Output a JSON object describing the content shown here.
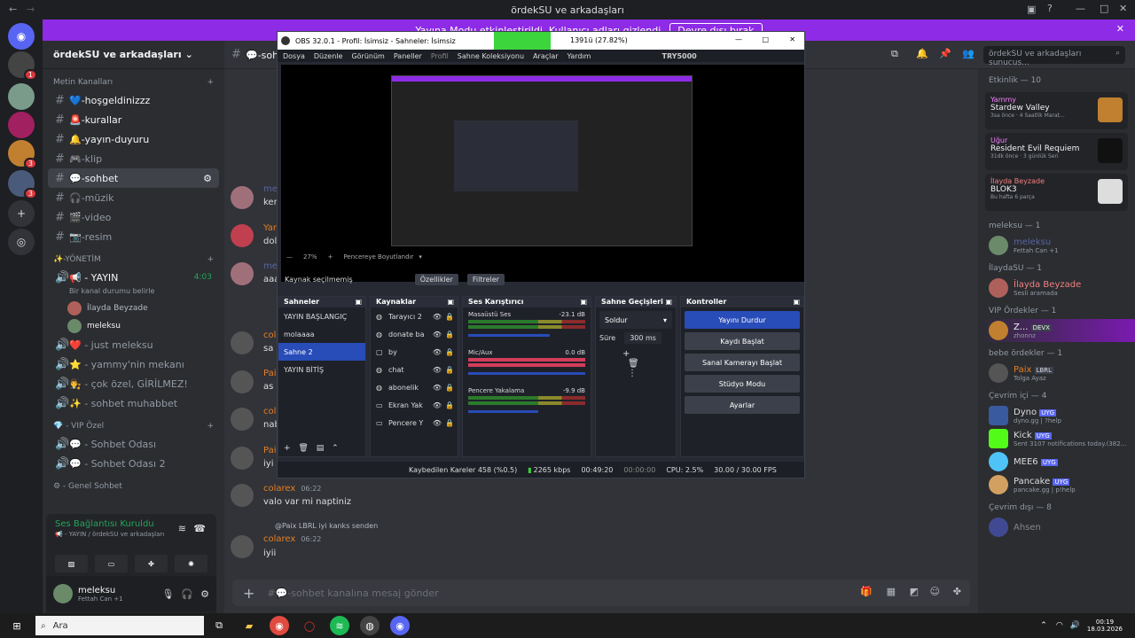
{
  "window": {
    "title": "ördekSU ve arkadaşları"
  },
  "banner": {
    "text": "Yayına Modu etkinleştirildi. Kullanıcı adları gizlendi",
    "button": "Devre dışı bırak"
  },
  "guilds": {
    "badges": [
      "1",
      "3",
      "3"
    ]
  },
  "server": {
    "name": "ördekSU ve arkadaşları"
  },
  "channels": {
    "text_category": "Metin Kanalları",
    "text": [
      "💙-hoşgeldinizzz",
      "🚨-kurallar",
      "🔔-yayın-duyuru",
      "🎮-klip",
      "💬-sohbet",
      "🎧-müzik",
      "🎬-video",
      "📷-resim"
    ],
    "mgmt_category": "✨-YÖNETİM",
    "live_channel": "📢 - YAYIN",
    "live_time": "4:03",
    "live_sub": "Bir kanal durumu belirle",
    "voice_users": [
      "İlayda Beyzade",
      "meleksu"
    ],
    "other": [
      "❤️ - just meleksu",
      "⭐ - yammy'nin mekanı",
      "👨‍⚖️ - çok özel, GİRİLMEZ!",
      "✨ - sohbet muhabbet"
    ],
    "vip_category": "💎 - VIP Özel",
    "vip": [
      "💬 - Sohbet Odası",
      "💬 - Sohbet Odası 2"
    ],
    "general_category": "⚙ - Genel Sohbet"
  },
  "voice_panel": {
    "status": "Ses Bağlantısı Kuruldu",
    "sub": "📢 - YAYIN / ördekSU ve arkadaşları"
  },
  "user": {
    "name": "meleksu",
    "sub": "Fettah Can +1"
  },
  "chat": {
    "channel": "💬-sohbet",
    "messages": [
      {
        "name": "meleksu",
        "text": "ker"
      },
      {
        "name": "Yam",
        "text": "dol"
      },
      {
        "name": "meleksu",
        "text": "aaa"
      },
      {
        "name": "colarex",
        "text": "sa"
      },
      {
        "name": "Pai",
        "text": "as"
      },
      {
        "name": "colarex",
        "text": "nab"
      },
      {
        "name": "Pai",
        "text": "iyi l"
      },
      {
        "name": "colarex",
        "time": "06:22",
        "text": "valo var mi naptiniz"
      },
      {
        "reply": "@Paix LBRL iyi kanks senden",
        "name": "colarex",
        "time": "06:22",
        "text": "iyii"
      }
    ],
    "input_placeholder": "#💬-sohbet kanalına mesaj gönder"
  },
  "search": {
    "placeholder": "ördekSU ve arkadaşları sunucus..."
  },
  "members": {
    "activity_header": "Etkinlik — 10",
    "activities": [
      {
        "user": "Yammy",
        "game": "Stardew Valley",
        "sub": "3sa önce · 4 Saatlik Marat..."
      },
      {
        "user": "Uğur",
        "game": "Resident Evil Requiem",
        "sub": "31dk önce · 3 günlük Seri"
      },
      {
        "user": "İlayda Beyzade",
        "game": "BLOK3",
        "sub": "Bu hafta 6 parça"
      }
    ],
    "groups": [
      {
        "title": "meleksu — 1",
        "items": [
          {
            "name": "meleksu",
            "sub": "Fettah Can +1"
          }
        ]
      },
      {
        "title": "İlaydaSU — 1",
        "items": [
          {
            "name": "İlayda Beyzade",
            "sub": "Sesli aramada"
          }
        ]
      },
      {
        "title": "VIP Ördekler — 1",
        "items": [
          {
            "name": "Z...",
            "sub": "zhonnz",
            "tag": "DEVX"
          }
        ]
      },
      {
        "title": "bebe ördekler — 1",
        "items": [
          {
            "name": "Paix",
            "sub": "Tolga Ayaz",
            "tag": "LBRL"
          }
        ]
      },
      {
        "title": "Çevrim içi — 4",
        "items": [
          {
            "name": "Dyno",
            "sub": "dyno.gg | ?help",
            "tag": "UYG"
          },
          {
            "name": "Kick",
            "sub": "Sent 3107 notifications today.(382...",
            "tag": "UYG"
          },
          {
            "name": "MEE6",
            "sub": "",
            "tag": "UYG"
          },
          {
            "name": "Pancake",
            "sub": "pancake.gg | p!help",
            "tag": "UYG"
          }
        ]
      },
      {
        "title": "Çevrim dışı — 8",
        "items": [
          {
            "name": "Ahsen",
            "sub": ""
          }
        ]
      }
    ]
  },
  "obs": {
    "title": "OBS 32.0.1 - Profil: İsimsiz - Sahneler: İsimsiz",
    "overlay_text": "1391ü (27.82%)",
    "menu": [
      "Dosya",
      "Düzenle",
      "Görünüm",
      "Paneller",
      "Profil",
      "Sahne Koleksiyonu",
      "Araçlar",
      "Yardım"
    ],
    "watermark": "TRY5000",
    "zoom": "27%",
    "fit": "Pencereye Boyutlandır",
    "no_source": "Kaynak seçilmemiş",
    "props": "Özellikler",
    "filters": "Filtreler",
    "docks": {
      "scenes": "Sahneler",
      "sources": "Kaynaklar",
      "mixer": "Ses Karıştırıcı",
      "transitions": "Sahne Geçişleri",
      "controls": "Kontroller"
    },
    "scenes": [
      "YAYIN BAŞLANGIÇ",
      "molaaaa",
      "Sahne 2",
      "YAYIN BİTİŞ"
    ],
    "selected_scene": 2,
    "sources": [
      "Tarayıcı 2",
      "donate ba",
      "by",
      "chat",
      "abonelik",
      "Ekran Yak",
      "Pencere Y"
    ],
    "mixer": [
      {
        "name": "Masaüstü Ses",
        "db": "-23.1 dB"
      },
      {
        "name": "Mic/Aux",
        "db": "0.0 dB"
      },
      {
        "name": "Pencere Yakalama",
        "db": "-9.9 dB"
      }
    ],
    "transition": "Soldur",
    "duration_label": "Süre",
    "duration": "300 ms",
    "controls": [
      "Yayını Durdur",
      "Kaydı Başlat",
      "Sanal Kamerayı Başlat",
      "Stüdyo Modu",
      "Ayarlar"
    ],
    "status": {
      "dropped": "Kaybedilen Kareler 458 (%0.5)",
      "bitrate": "2265 kbps",
      "live": "00:49:20",
      "rec": "00:00:00",
      "cpu": "CPU: 2.5%",
      "fps": "30.00 / 30.00 FPS"
    }
  },
  "taskbar": {
    "search": "Ara",
    "time": "00:19",
    "date": "18.03.2026"
  }
}
